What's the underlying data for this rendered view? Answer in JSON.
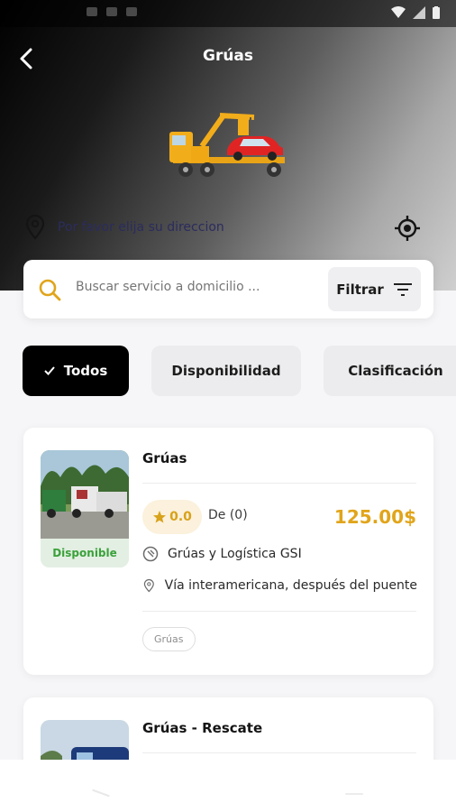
{
  "header": {
    "title": "Grúas",
    "location_placeholder": "Por favor elija su direccion"
  },
  "search": {
    "placeholder": "Buscar servicio a domicilio ...",
    "filter_label": "Filtrar"
  },
  "chips": [
    {
      "label": "Todos",
      "selected": true
    },
    {
      "label": "Disponibilidad",
      "selected": false
    },
    {
      "label": "Clasificación",
      "selected": false
    }
  ],
  "listings": [
    {
      "title": "Grúas",
      "status": "Disponible",
      "rating": "0.0",
      "reviews": "De (0)",
      "price": "125.00$",
      "company": "Grúas y Logística GSI",
      "address": "Vía interamericana, después del puente",
      "tag": "Grúas"
    },
    {
      "title": "Grúas - Rescate"
    }
  ],
  "colors": {
    "accent": "#e1a51b",
    "available_green": "#3aa13a",
    "location_text": "#2b2c5e"
  }
}
